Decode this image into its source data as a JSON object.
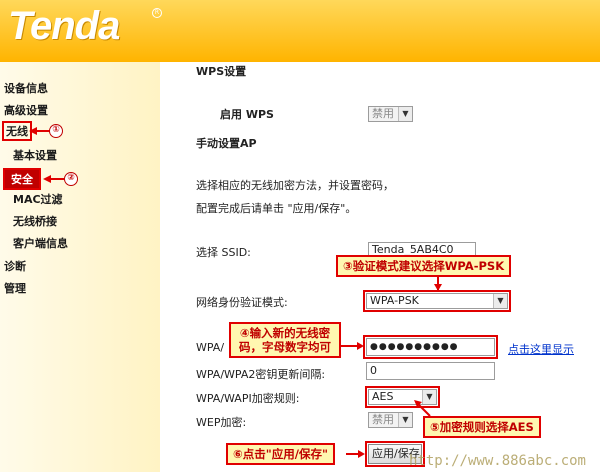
{
  "brand": {
    "logo": "Tenda",
    "reg_mark": "R"
  },
  "sidebar": {
    "items": [
      {
        "label": "设备信息"
      },
      {
        "label": "高级设置"
      },
      {
        "label": "无线"
      },
      {
        "label": "基本设置"
      },
      {
        "label": "安全"
      },
      {
        "label": "MAC过滤"
      },
      {
        "label": "无线桥接"
      },
      {
        "label": "客户端信息"
      },
      {
        "label": "诊断"
      },
      {
        "label": "管理"
      }
    ]
  },
  "main": {
    "wps_section": "WPS设置",
    "wps_enable_label": "启用 WPS",
    "wps_value": "禁用",
    "manual_ap": "手动设置AP",
    "desc_line1": "选择相应的无线加密方法，并设置密码，",
    "desc_line2": "配置完成后请单击 \"应用/保存\"。",
    "ssid_label": "选择 SSID:",
    "ssid_value": "Tenda_5AB4C0",
    "auth_label": "网络身份验证模式:",
    "auth_value": "WPA-PSK",
    "wpa_label": "WPA/",
    "password_value": "●●●●●●●●●●",
    "show_link": "点击这里显示",
    "renew_label": "WPA/WPA2密钥更新间隔:",
    "renew_value": "0",
    "encrypt_label": "WPA/WAPI加密规则:",
    "encrypt_value": "AES",
    "wep_label": "WEP加密:",
    "wep_value": "禁用",
    "apply_button": "应用/保存"
  },
  "annotations": {
    "c1": "①",
    "c2": "②",
    "c3": "③",
    "c4": "④",
    "c5": "⑤",
    "c6": "⑥",
    "callout3": "验证模式建议选择WPA-PSK",
    "callout4": "输入新的无线密码，字母数字均可",
    "callout5": "加密规则选择AES",
    "callout6": "点击\"应用/保存\""
  },
  "watermark": "http://www.886abc.com",
  "colors": {
    "header": "#ffc21a",
    "accent_red": "#e00000",
    "link": "#0033cc"
  }
}
